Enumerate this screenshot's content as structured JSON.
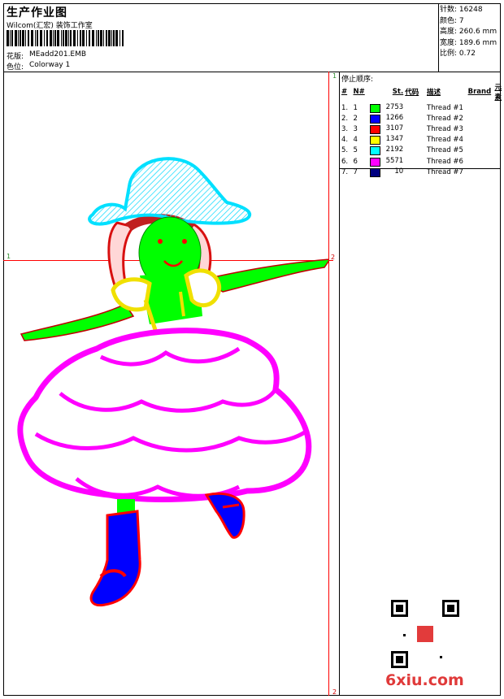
{
  "header": {
    "title": "生产作业图",
    "company": "Wilcom(汇宏) 装饰工作室",
    "design_label": "花版:",
    "design_value": "MEadd201.EMB",
    "color_label": "色位:",
    "color_value": "Colorway 1"
  },
  "stats": [
    {
      "label": "针数:",
      "value": "16248"
    },
    {
      "label": "颜色:",
      "value": "7"
    },
    {
      "label": "高度:",
      "value": "260.6 mm"
    },
    {
      "label": "宽度:",
      "value": "189.6 mm"
    },
    {
      "label": "比例:",
      "value": "0.72"
    }
  ],
  "sequence": {
    "title": "停止顺序:",
    "headers": {
      "hash": "#",
      "n": "N#",
      "st": "St.",
      "code": "代码",
      "desc": "描述",
      "brand": "Brand",
      "elem": "元素"
    },
    "rows": [
      {
        "num": "1.",
        "n": "1",
        "color": "#00ff00",
        "st": "2753",
        "desc": "Thread #1"
      },
      {
        "num": "2.",
        "n": "2",
        "color": "#0000ff",
        "st": "1266",
        "desc": "Thread #2"
      },
      {
        "num": "3.",
        "n": "3",
        "color": "#ff0000",
        "st": "3107",
        "desc": "Thread #3"
      },
      {
        "num": "4.",
        "n": "4",
        "color": "#ffff00",
        "st": "1347",
        "desc": "Thread #4"
      },
      {
        "num": "5.",
        "n": "5",
        "color": "#00ffff",
        "st": "2192",
        "desc": "Thread #5"
      },
      {
        "num": "6.",
        "n": "6",
        "color": "#ff00ff",
        "st": "5571",
        "desc": "Thread #6"
      },
      {
        "num": "7.",
        "n": "7",
        "color": "#000080",
        "st": "10",
        "desc": "Thread #7"
      }
    ]
  },
  "markers": {
    "top_right": "1",
    "left": "1",
    "bottom_right": "2",
    "right_mid": "2"
  },
  "watermark": "6xiu.com",
  "colors": {
    "border": "#000000",
    "guide": "#ff0000",
    "marker": "#2a8a2a"
  }
}
